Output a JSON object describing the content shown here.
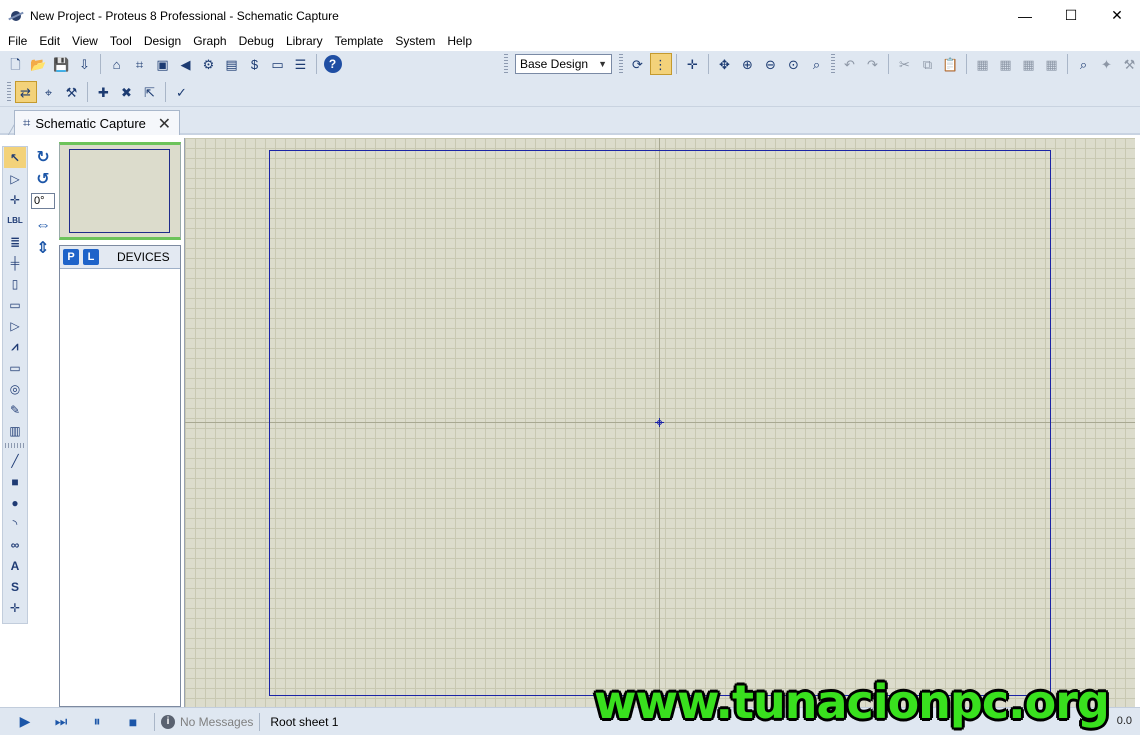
{
  "window": {
    "title": "New Project - Proteus 8 Professional - Schematic Capture",
    "minimize": "—",
    "maximize": "☐",
    "close": "✕"
  },
  "menu": [
    "File",
    "Edit",
    "View",
    "Tool",
    "Design",
    "Graph",
    "Debug",
    "Library",
    "Template",
    "System",
    "Help"
  ],
  "toolbar": {
    "row1_left": [
      {
        "name": "new-file-icon",
        "glyph": "🗋"
      },
      {
        "name": "open-folder-icon",
        "glyph": "📂"
      },
      {
        "name": "save-icon",
        "glyph": "💾"
      },
      {
        "name": "import-icon",
        "glyph": "⇩"
      },
      {
        "sep": true
      },
      {
        "name": "home-icon",
        "glyph": "⌂"
      },
      {
        "name": "schematic-icon",
        "glyph": "⌗"
      },
      {
        "name": "pcb-icon",
        "glyph": "▣"
      },
      {
        "name": "simulation-icon",
        "glyph": "◀"
      },
      {
        "name": "3d-viewer-icon",
        "glyph": "⚙"
      },
      {
        "name": "gerber-icon",
        "glyph": "▤"
      },
      {
        "name": "bom-icon",
        "glyph": "$"
      },
      {
        "name": "vsm-studio-icon",
        "glyph": "▭"
      },
      {
        "name": "notes-icon",
        "glyph": "☰"
      },
      {
        "sep": true
      },
      {
        "name": "help-icon",
        "glyph": "?"
      }
    ],
    "design_combo": "Base Design",
    "row1_right": [
      {
        "name": "refresh-icon",
        "glyph": "⟳"
      },
      {
        "name": "grid-toggle-icon",
        "glyph": "⋮",
        "active": true
      },
      {
        "sep": true
      },
      {
        "name": "origin-icon",
        "glyph": "✛"
      },
      {
        "sep": true
      },
      {
        "name": "pan-icon",
        "glyph": "✥"
      },
      {
        "name": "zoom-in-icon",
        "glyph": "⊕"
      },
      {
        "name": "zoom-out-icon",
        "glyph": "⊖"
      },
      {
        "name": "zoom-all-icon",
        "glyph": "⊙"
      },
      {
        "name": "zoom-area-icon",
        "glyph": "⌕"
      },
      {
        "grip": true
      },
      {
        "name": "undo-icon",
        "glyph": "↶",
        "gray": true
      },
      {
        "name": "redo-icon",
        "glyph": "↷",
        "gray": true
      },
      {
        "sep": true
      },
      {
        "name": "cut-icon",
        "glyph": "✂",
        "gray": true
      },
      {
        "name": "copy-icon",
        "glyph": "⧉",
        "gray": true
      },
      {
        "name": "paste-icon",
        "glyph": "📋",
        "gray": true
      },
      {
        "sep": true
      },
      {
        "name": "block-copy-icon",
        "glyph": "▦",
        "gray": true
      },
      {
        "name": "block-move-icon",
        "glyph": "▦",
        "gray": true
      },
      {
        "name": "block-rotate-icon",
        "glyph": "▦",
        "gray": true
      },
      {
        "name": "block-delete-icon",
        "glyph": "▦",
        "gray": true
      },
      {
        "sep": true
      },
      {
        "name": "pick-device-icon",
        "glyph": "⌕"
      },
      {
        "name": "make-device-icon",
        "glyph": "✦",
        "gray": true
      },
      {
        "name": "packaging-tool-icon",
        "glyph": "⚒",
        "gray": true
      },
      {
        "name": "decompose-icon",
        "glyph": "⚒",
        "gray": true
      }
    ],
    "row2": [
      {
        "name": "wire-autorouter-icon",
        "glyph": "⇄",
        "active": true
      },
      {
        "name": "search-tag-icon",
        "glyph": "⌖"
      },
      {
        "name": "property-tool-icon",
        "glyph": "⚒"
      },
      {
        "sep": true
      },
      {
        "name": "new-sheet-icon",
        "glyph": "✚"
      },
      {
        "name": "remove-sheet-icon",
        "glyph": "✖"
      },
      {
        "name": "exit-to-parent-icon",
        "glyph": "⇱"
      },
      {
        "sep": true
      },
      {
        "name": "electrical-rule-check-icon",
        "glyph": "✓"
      }
    ]
  },
  "tab": {
    "label": "Schematic Capture",
    "close": "✕"
  },
  "modes": [
    {
      "name": "selection-mode-icon",
      "glyph": "↖",
      "active": true
    },
    {
      "name": "component-mode-icon",
      "glyph": "▷"
    },
    {
      "name": "junction-dot-icon",
      "glyph": "✛"
    },
    {
      "name": "wire-label-icon",
      "glyph": "LBL"
    },
    {
      "name": "text-script-icon",
      "glyph": "≣"
    },
    {
      "name": "buses-icon",
      "glyph": "╪"
    },
    {
      "name": "subcircuit-icon",
      "glyph": "▯"
    },
    {
      "name": "terminals-icon",
      "glyph": "▭"
    },
    {
      "name": "device-pins-icon",
      "glyph": "▷"
    },
    {
      "name": "graph-mode-icon",
      "glyph": "⩘"
    },
    {
      "name": "tape-recorder-icon",
      "glyph": "▭"
    },
    {
      "name": "generator-icon",
      "glyph": "◎"
    },
    {
      "name": "voltage-probe-icon",
      "glyph": "✎"
    },
    {
      "name": "virtual-instruments-icon",
      "glyph": "▥"
    },
    {
      "grip": true
    },
    {
      "name": "line-2d-icon",
      "glyph": "╱"
    },
    {
      "name": "box-2d-icon",
      "glyph": "■"
    },
    {
      "name": "circle-2d-icon",
      "glyph": "●"
    },
    {
      "name": "arc-2d-icon",
      "glyph": "◝"
    },
    {
      "name": "path-2d-icon",
      "glyph": "∞"
    },
    {
      "name": "text-2d-icon",
      "glyph": "A"
    },
    {
      "name": "symbol-2d-icon",
      "glyph": "S"
    },
    {
      "name": "marker-2d-icon",
      "glyph": "✛"
    }
  ],
  "orientation": {
    "rotate_cw": "↻",
    "rotate_ccw": "↺",
    "angle": "0°",
    "mirror_x": "⇔",
    "mirror_y": "⇕"
  },
  "devices": {
    "p_button": "P",
    "l_button": "L",
    "title": "DEVICES"
  },
  "status": {
    "play": "▶",
    "step": "⏭",
    "pause": "⏸",
    "stop": "■",
    "info": "i",
    "messages": "No Messages",
    "sheet": "Root sheet 1",
    "coords": "0.0"
  },
  "watermark": "www.tunacionpc.org"
}
